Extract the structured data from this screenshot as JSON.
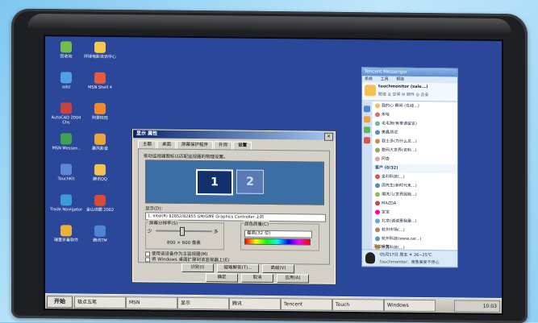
{
  "desktop": {
    "icons": [
      {
        "label": "回收站",
        "color": "#6fbf4a"
      },
      {
        "label": "环球电影资讯中心",
        "color": "#f3c84b"
      },
      {
        "label": "adsl",
        "color": "#4fa0e8"
      },
      {
        "label": "MSN Shell 4",
        "color": "#e65b3a"
      },
      {
        "label": "AutoCAD 2004 Chs",
        "color": "#c9433a"
      },
      {
        "label": "阿里旺旺",
        "color": "#f28a2b"
      },
      {
        "label": "MSN Messen..",
        "color": "#3fa34d"
      },
      {
        "label": "暴风影音",
        "color": "#e9a53b"
      },
      {
        "label": "TouchKit",
        "color": "#5c88d6"
      },
      {
        "label": "腾讯QQ",
        "color": "#f2c14e"
      },
      {
        "label": "Trade Navigator",
        "color": "#3f9ad8"
      },
      {
        "label": "金山词霸 2002",
        "color": "#d94a3a"
      },
      {
        "label": "瑞星杀毒软件",
        "color": "#e8b33a"
      },
      {
        "label": "腾讯TM",
        "color": "#4b86d6"
      }
    ]
  },
  "dialog": {
    "title": "显示 属性",
    "close": "×",
    "tabs": [
      "主题",
      "桌面",
      "屏幕保护程序",
      "外观",
      "设置"
    ],
    "active_tab": 4,
    "hint": "拖动监视器图标以匹配监视器的物理设置。",
    "monitor1": "1",
    "monitor2": "2",
    "display_label": "显示(D):",
    "display_value": "1. Intel(R) 82852/82855 GM/GME Graphics Controller 上的",
    "resolution_group": "屏幕分辨率(S)",
    "res_less": "少",
    "res_more": "多",
    "resolution_value": "800 × 600 像素",
    "color_group": "颜色质量(C)",
    "color_value": "最高(32 位)",
    "cb_primary": "使用该设备作为主监视器(M)",
    "cb_extend": "将 Windows 桌面扩展到该监视器上(E)",
    "btn_identify": "识别(I)",
    "btn_troubleshoot": "疑难解答(T)...",
    "btn_advanced": "高级(V)",
    "btn_ok": "确定",
    "btn_cancel": "取消",
    "btn_apply": "应用(A)"
  },
  "messenger": {
    "title": "Tencent Messenger",
    "menu": [
      "系统",
      "工具",
      "帮助"
    ],
    "user_name": "touchmonitor (sale...)",
    "user_status": "短信  ◎ 空间  ✉ 邮件  ◎ 企业",
    "contacts": [
      {
        "name": "我的心·瞬间 (在线...)",
        "color": "#f2c14e",
        "group": false
      },
      {
        "name": "朱哈",
        "color": "#e66",
        "group": false
      },
      {
        "name": "毛毛狗(有事请留言)",
        "color": "#6b9",
        "group": false
      },
      {
        "name": "美鑫测试",
        "color": "#58c",
        "group": false
      },
      {
        "name": "我士多(为什么总...)",
        "color": "#c85",
        "group": false
      },
      {
        "name": "数码大世界(资料...)",
        "color": "#8a6",
        "group": false
      },
      {
        "name": "阿杏",
        "color": "#e9a",
        "group": false
      },
      {
        "name": "客户 (0/32)",
        "color": "#246",
        "group": true
      },
      {
        "name": "金利科技(...)",
        "color": "#d54",
        "group": false
      },
      {
        "name": "周先生(新时代来...)",
        "color": "#58c",
        "group": false
      },
      {
        "name": "潮流儿(世界因我...)",
        "color": "#9b5",
        "group": false
      },
      {
        "name": "MAZDA",
        "color": "#c44",
        "group": false
      },
      {
        "name": "宝宝",
        "color": "#f0a",
        "group": false
      },
      {
        "name": "北京(诚诚是我最...)",
        "color": "#6ad",
        "group": false
      },
      {
        "name": "杭州市场(...)",
        "color": "#a86",
        "group": false
      },
      {
        "name": "杭州科技(www.cer...)",
        "color": "#59c",
        "group": false
      },
      {
        "name": "东莞科技(...)",
        "color": "#d93",
        "group": false
      }
    ],
    "add_contact": "添加好友",
    "date": "05月17日 周五  ☀ 26~25℃",
    "footer": "touchmonitor：黄鲁美爱不停心"
  },
  "taskbar": {
    "start": "开始",
    "items": [
      "极点五笔",
      "MSN",
      "显示",
      "腾讯",
      "Tencent",
      "Touch",
      "Windows"
    ],
    "tray": "10:03"
  }
}
